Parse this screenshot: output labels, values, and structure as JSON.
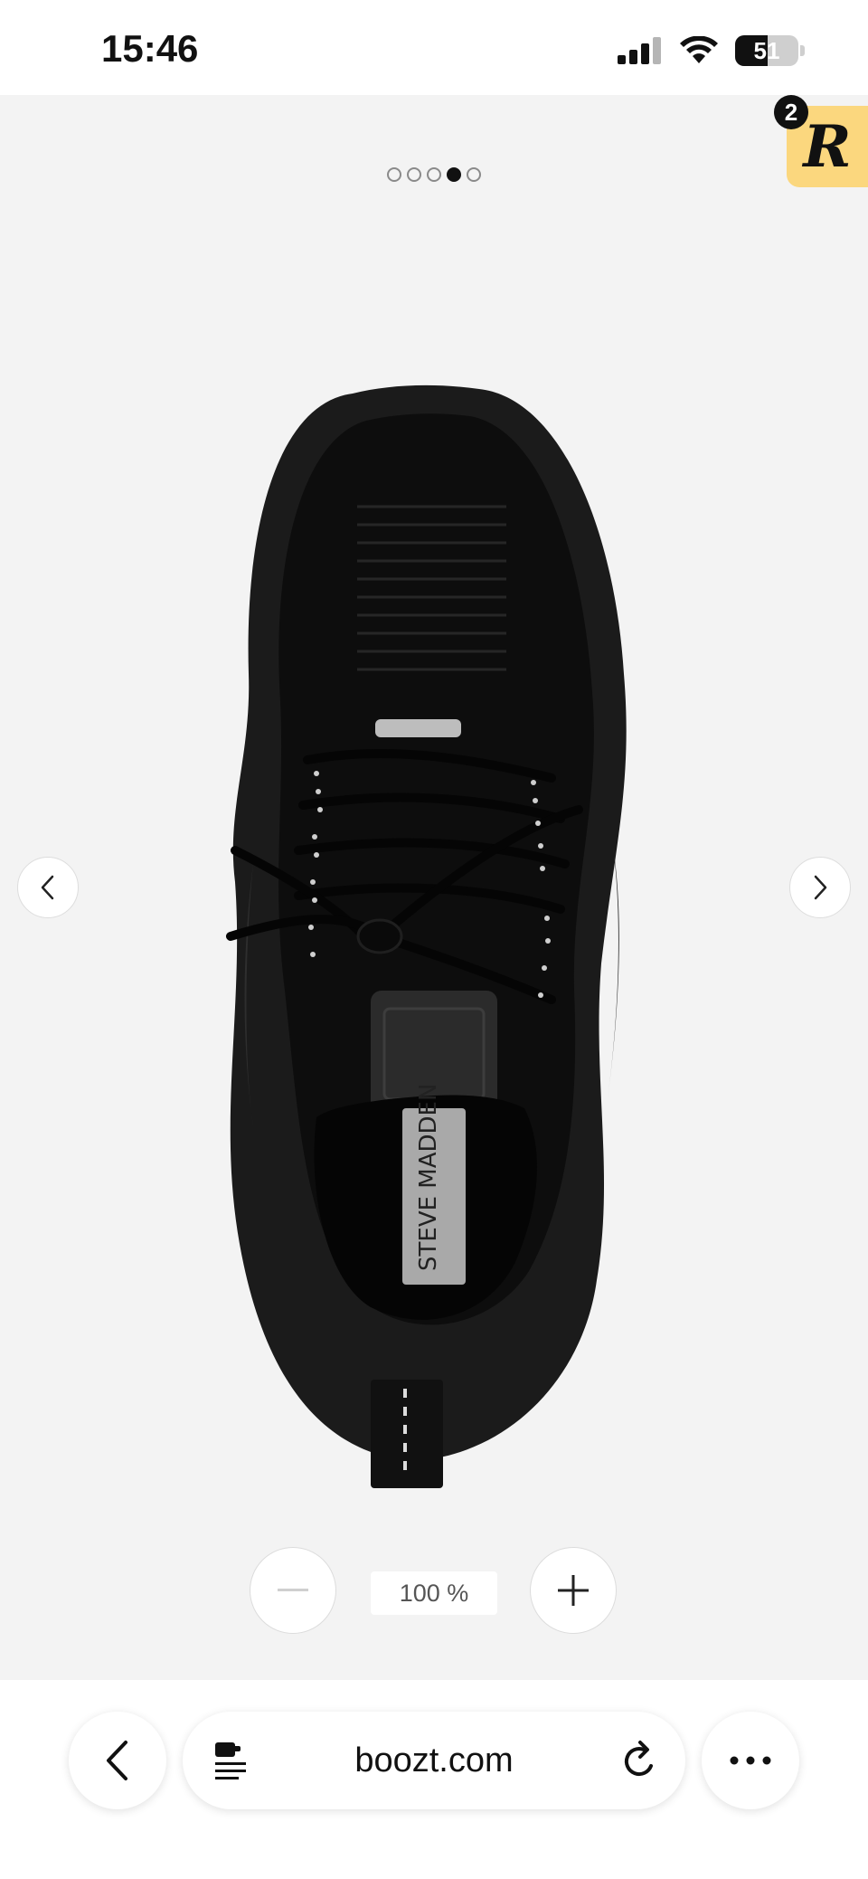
{
  "status_bar": {
    "time": "15:46",
    "battery_percent": 51,
    "battery_text": "51",
    "signal_icon": "cellular-signal-icon",
    "wifi_icon": "wifi-icon"
  },
  "gallery": {
    "dot_count": 5,
    "active_index": 3,
    "prev_icon": "chevron-left-icon",
    "next_icon": "chevron-right-icon",
    "product_label_text": "STEVE MADDEN"
  },
  "rakuten_badge": {
    "letter": "R",
    "count": "2",
    "color": "#fbd77e"
  },
  "zoom": {
    "level": "100 %",
    "zoom_out_icon": "minus-icon",
    "zoom_in_icon": "plus-icon"
  },
  "browser": {
    "url": "boozt.com",
    "back_icon": "chevron-left-icon",
    "reader_icon": "reader-mode-icon",
    "reload_icon": "reload-icon",
    "more_icon": "more-dots-icon"
  }
}
